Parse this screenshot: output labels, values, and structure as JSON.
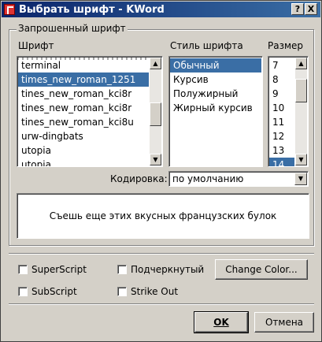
{
  "window": {
    "title": "Выбрать шрифт - KWord",
    "help_label": "?",
    "close_label": "X"
  },
  "group": {
    "label": "Запрошенный шрифт"
  },
  "font_list": {
    "header": "Шрифт",
    "items": [
      "terminal",
      "times_new_roman_1251",
      "tines_new_roman_kci8r",
      "tines_new_roman_kci8r",
      "tines_new_roman_kci8u",
      "urw-dingbats",
      "utopia",
      "utopia"
    ],
    "selected_index": 1,
    "scroll_fraction": 0.55
  },
  "style_list": {
    "header": "Стиль шрифта",
    "items": [
      "Обычный",
      "Курсив",
      "Полужирный",
      "Жирный курсив"
    ],
    "selected_index": 0
  },
  "size_list": {
    "header": "Размер",
    "items": [
      "7",
      "8",
      "9",
      "10",
      "11",
      "12",
      "13",
      "14"
    ],
    "selected_index": 7,
    "scroll_fraction": 0.15
  },
  "encoding": {
    "label": "Кодировка:",
    "value": "по умолчанию"
  },
  "preview": {
    "text": "Съешь еще этих вкусных французских булок"
  },
  "options": {
    "superscript": "SuperScript",
    "subscript": "SubScript",
    "underline": "Подчеркнутый",
    "strikeout": "Strike Out",
    "change_color": "Change Color..."
  },
  "buttons": {
    "ok": "OK",
    "cancel": "Отмена"
  },
  "colors": {
    "titlebar": "#0a246a",
    "selection": "#3a6ea5",
    "face": "#d4d0c8"
  }
}
